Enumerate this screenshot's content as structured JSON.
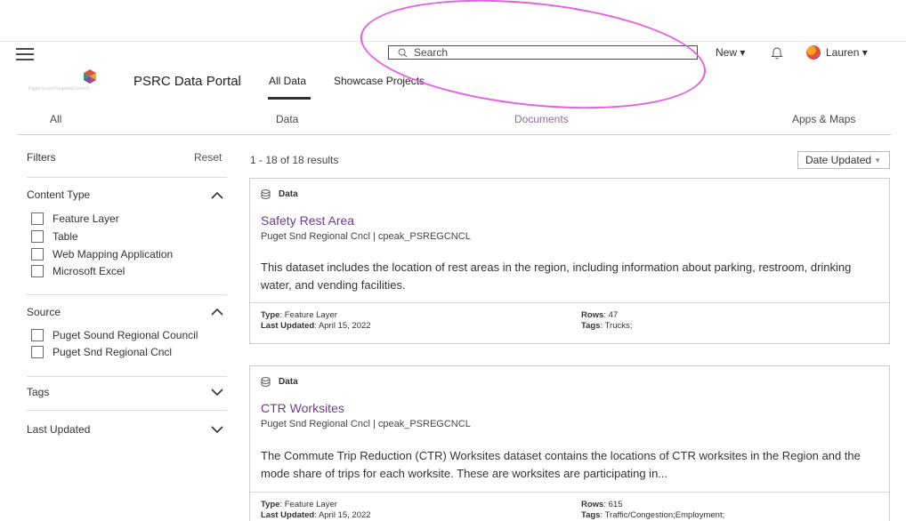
{
  "topbar": {
    "search_placeholder": "Search",
    "new_label": "New ▾",
    "user_label": "Lauren ▾"
  },
  "header": {
    "logo_tagline": "Puget Sound Regional Council",
    "portal_title": "PSRC Data Portal",
    "nav": [
      "All Data",
      "Showcase Projects"
    ]
  },
  "categories": [
    "All",
    "Data",
    "Documents",
    "Apps & Maps"
  ],
  "filters": {
    "title": "Filters",
    "reset": "Reset",
    "groups": [
      {
        "title": "Content Type",
        "options": [
          "Feature Layer",
          "Table",
          "Web Mapping Application",
          "Microsoft Excel"
        ]
      },
      {
        "title": "Source",
        "options": [
          "Puget Sound Regional Council",
          "Puget Snd Regional Cncl"
        ]
      },
      {
        "title": "Tags",
        "options": []
      },
      {
        "title": "Last Updated",
        "options": []
      }
    ]
  },
  "results": {
    "count": "1 - 18 of 18 results",
    "sort": "Date Updated",
    "items": [
      {
        "type": "Data",
        "title": "Safety Rest Area",
        "owner": "Puget Snd Regional Cncl | cpeak_PSREGCNCL",
        "description": "This dataset includes the location of rest areas in the region, including information about parking, restroom, drinking water, and vending facilities.",
        "type_label": "Type",
        "type_value": ": Feature Layer",
        "updated_label": "Last Updated",
        "updated_value": ": April 15, 2022",
        "rows_label": "Rows",
        "rows_value": ": 47",
        "tags_label": "Tags",
        "tags_value": ": Trucks;"
      },
      {
        "type": "Data",
        "title": "CTR Worksites",
        "owner": "Puget Snd Regional Cncl | cpeak_PSREGCNCL",
        "description": "The Commute Trip Reduction (CTR) Worksites dataset contains the locations of CTR worksites in the Region and the mode share of trips for each worksite. These are worksites are participating in...",
        "type_label": "Type",
        "type_value": ": Feature Layer",
        "updated_label": "Last Updated",
        "updated_value": ": April 15, 2022",
        "rows_label": "Rows",
        "rows_value": ": 615",
        "tags_label": "Tags",
        "tags_value": ": Traffic/Congestion;Employment;"
      }
    ]
  },
  "colors": {
    "accent_purple": "#6b3e8c",
    "documents_tab": "#8d6ca3",
    "annotation_ellipse": "#e85de3"
  }
}
